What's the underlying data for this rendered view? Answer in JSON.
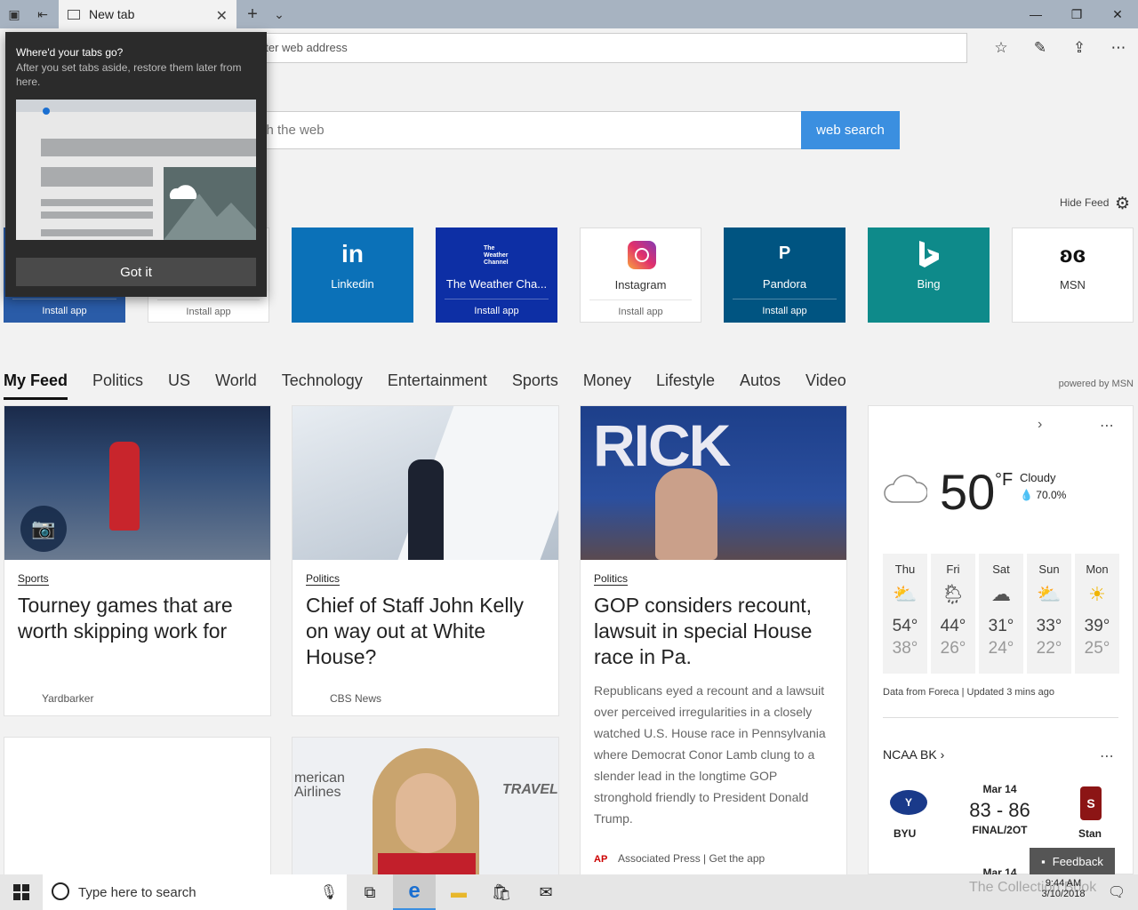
{
  "window": {
    "tab_title": "New tab",
    "new_tab_icon": "plus-icon"
  },
  "addressbar": {
    "placeholder": "nter web address"
  },
  "search": {
    "placeholder": "rch the web",
    "button": "web search"
  },
  "feed_controls": {
    "hide_feed": "Hide Feed"
  },
  "popup": {
    "title": "Where'd your tabs go?",
    "body": "After you set tabs aside, restore them later from here.",
    "button": "Got it"
  },
  "top_sites": [
    {
      "label": "",
      "install": "Install app",
      "color": "#2a5ca8"
    },
    {
      "label": "",
      "install": "Install app",
      "color": "#ffffff"
    },
    {
      "logo": "in",
      "label": "Linkedin",
      "install": "",
      "color": "#0b71b8"
    },
    {
      "logo": "The Weather Channel",
      "label": "The Weather Cha...",
      "install": "Install app",
      "color": "#0d2fa5"
    },
    {
      "label": "Instagram",
      "install": "Install app",
      "color": "#ffffff"
    },
    {
      "logo": "P",
      "label": "Pandora",
      "install": "Install app",
      "color": "#005481"
    },
    {
      "label": "Bing",
      "install": "",
      "color": "#0e8a8a"
    },
    {
      "label": "MSN",
      "install": "",
      "color": "#ffffff"
    }
  ],
  "feed": {
    "categories": [
      "My Feed",
      "Politics",
      "US",
      "World",
      "Technology",
      "Entertainment",
      "Sports",
      "Money",
      "Lifestyle",
      "Autos",
      "Video"
    ],
    "powered_by": "powered by MSN",
    "cards": [
      {
        "category": "Sports",
        "title": "Tourney games that are worth skipping work for",
        "source": "Yardbarker"
      },
      {
        "category": "Politics",
        "title": "Chief of Staff John Kelly on way out at White House?",
        "source": "CBS News"
      },
      {
        "category": "Politics",
        "title": "GOP considers recount, lawsuit in special House race in Pa.",
        "description": "Republicans eyed a recount and a lawsuit over perceived irregularities in a closely watched U.S. House race in Pennsylvania where Democrat Conor Lamb clung to a slender lead in the longtime GOP stronghold friendly to President Donald Trump.",
        "source": "Associated Press | Get the app"
      }
    ]
  },
  "weather": {
    "temp": "50",
    "unit": "°F",
    "condition": "Cloudy",
    "humidity": "70.0%",
    "days": [
      {
        "name": "Thu",
        "hi": "54°",
        "lo": "38°",
        "icon": "partly-sunny-icon"
      },
      {
        "name": "Fri",
        "hi": "44°",
        "lo": "26°",
        "icon": "rain-sun-icon"
      },
      {
        "name": "Sat",
        "hi": "31°",
        "lo": "24°",
        "icon": "cloud-icon"
      },
      {
        "name": "Sun",
        "hi": "33°",
        "lo": "22°",
        "icon": "partly-sunny-icon"
      },
      {
        "name": "Mon",
        "hi": "39°",
        "lo": "25°",
        "icon": "sun-icon"
      }
    ],
    "footer": "Data from Foreca | Updated 3 mins ago"
  },
  "sports": {
    "league": "NCAA BK",
    "date": "Mar 14",
    "score": "83 - 86",
    "status": "FINAL/2OT",
    "team_left": "BYU",
    "team_right": "Stan",
    "next_date": "Mar 14"
  },
  "feedback": "Feedback",
  "taskbar": {
    "search_placeholder": "Type here to search",
    "time": "9:44 AM",
    "date": "3/10/2018",
    "watermark": "The Collection Book"
  }
}
